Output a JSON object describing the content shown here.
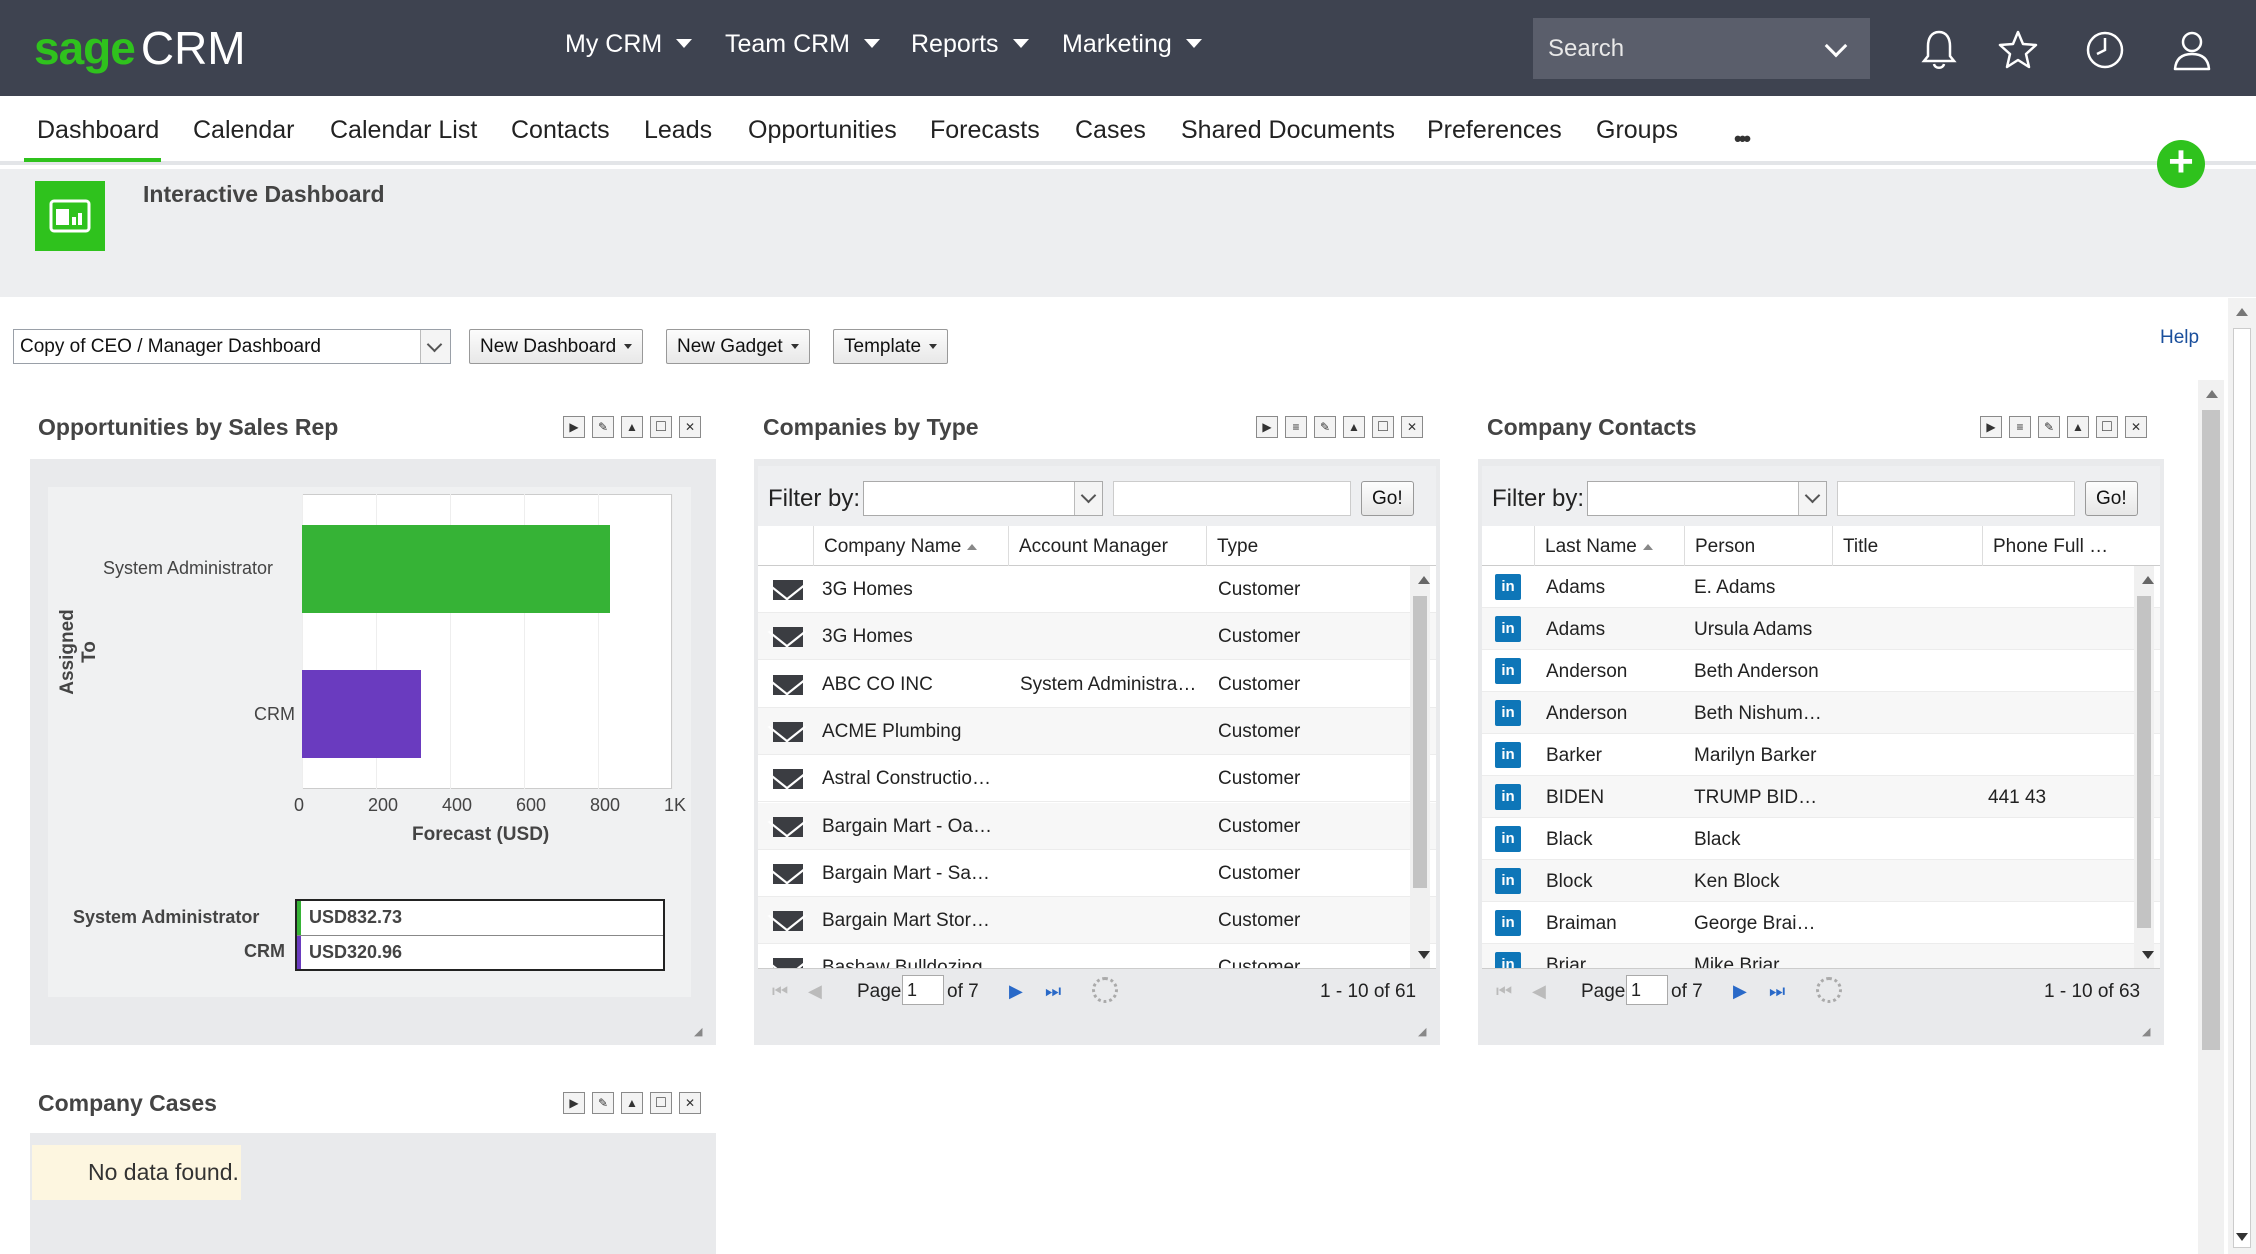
{
  "app": {
    "logo_sage": "sage",
    "logo_crm": "CRM",
    "accent": "#2fc21d",
    "topbar_color": "#3e4350"
  },
  "topnav": [
    {
      "label": "My CRM"
    },
    {
      "label": "Team CRM"
    },
    {
      "label": "Reports"
    },
    {
      "label": "Marketing"
    }
  ],
  "search": {
    "placeholder": "Search"
  },
  "top_icons": [
    "bell-icon",
    "star-icon",
    "clock-icon",
    "user-icon"
  ],
  "tabs": [
    {
      "label": "Dashboard",
      "active": true
    },
    {
      "label": "Calendar"
    },
    {
      "label": "Calendar List"
    },
    {
      "label": "Contacts"
    },
    {
      "label": "Leads"
    },
    {
      "label": "Opportunities"
    },
    {
      "label": "Forecasts"
    },
    {
      "label": "Cases"
    },
    {
      "label": "Shared Documents"
    },
    {
      "label": "Preferences"
    },
    {
      "label": "Groups"
    }
  ],
  "more_label": "•••",
  "add_label": "+",
  "page": {
    "title": "Interactive Dashboard"
  },
  "toolbar": {
    "dashboard_select": "Copy of CEO / Manager Dashboard",
    "new_dashboard": "New Dashboard",
    "new_gadget": "New Gadget",
    "template": "Template",
    "help": "Help"
  },
  "gadgets": {
    "opps": {
      "title": "Opportunities by Sales Rep",
      "chart_data": {
        "type": "bar",
        "orientation": "horizontal",
        "categories": [
          "System Administrator",
          "CRM"
        ],
        "values": [
          832.73,
          320.96
        ],
        "colors": [
          "#36b336",
          "#6a3bbf"
        ],
        "xlabel": "Forecast (USD)",
        "ylabel": "Assigned To",
        "xlim": [
          0,
          1000
        ],
        "xticks": [
          "0",
          "200",
          "400",
          "600",
          "800",
          "1K"
        ],
        "grid": true,
        "legend": [
          {
            "name": "System Administrator",
            "value": "USD832.73"
          },
          {
            "name": "CRM",
            "value": "USD320.96"
          }
        ]
      }
    },
    "companies": {
      "title": "Companies by Type",
      "filter_label": "Filter by:",
      "go_label": "Go!",
      "columns": [
        "Company Name",
        "Account Manager",
        "Type"
      ],
      "rows": [
        [
          "3G Homes",
          "",
          "Customer"
        ],
        [
          "3G Homes",
          "",
          "Customer"
        ],
        [
          "ABC CO INC",
          "System Administra…",
          "Customer"
        ],
        [
          "ACME Plumbing",
          "",
          "Customer"
        ],
        [
          "Astral Constructio…",
          "",
          "Customer"
        ],
        [
          "Bargain Mart - Oa…",
          "",
          "Customer"
        ],
        [
          "Bargain Mart - Sa…",
          "",
          "Customer"
        ],
        [
          "Bargain Mart Stor…",
          "",
          "Customer"
        ],
        [
          "Bashaw Bulldozing",
          "",
          "Customer"
        ]
      ],
      "pager": {
        "page_label": "Page",
        "page": "1",
        "of_label": "of 7",
        "summary": "1 - 10 of 61"
      }
    },
    "contacts": {
      "title": "Company Contacts",
      "filter_label": "Filter by:",
      "go_label": "Go!",
      "columns": [
        "Last Name",
        "Person",
        "Title",
        "Phone Full …"
      ],
      "rows": [
        [
          "Adams",
          "E. Adams",
          "",
          ""
        ],
        [
          "Adams",
          "Ursula Adams",
          "",
          ""
        ],
        [
          "Anderson",
          "Beth Anderson",
          "",
          ""
        ],
        [
          "Anderson",
          "Beth Nishum…",
          "",
          ""
        ],
        [
          "Barker",
          "Marilyn Barker",
          "",
          ""
        ],
        [
          "BIDEN",
          "TRUMP BID…",
          "",
          "441 43"
        ],
        [
          "Black",
          "Black",
          "",
          ""
        ],
        [
          "Block",
          "Ken Block",
          "",
          ""
        ],
        [
          "Braiman",
          "George Brai…",
          "",
          ""
        ],
        [
          "Briar",
          "Mike Briar",
          "",
          ""
        ]
      ],
      "pager": {
        "page_label": "Page",
        "page": "1",
        "of_label": "of 7",
        "summary": "1 - 10 of 63"
      }
    },
    "cases": {
      "title": "Company Cases",
      "empty": "No data found."
    }
  }
}
